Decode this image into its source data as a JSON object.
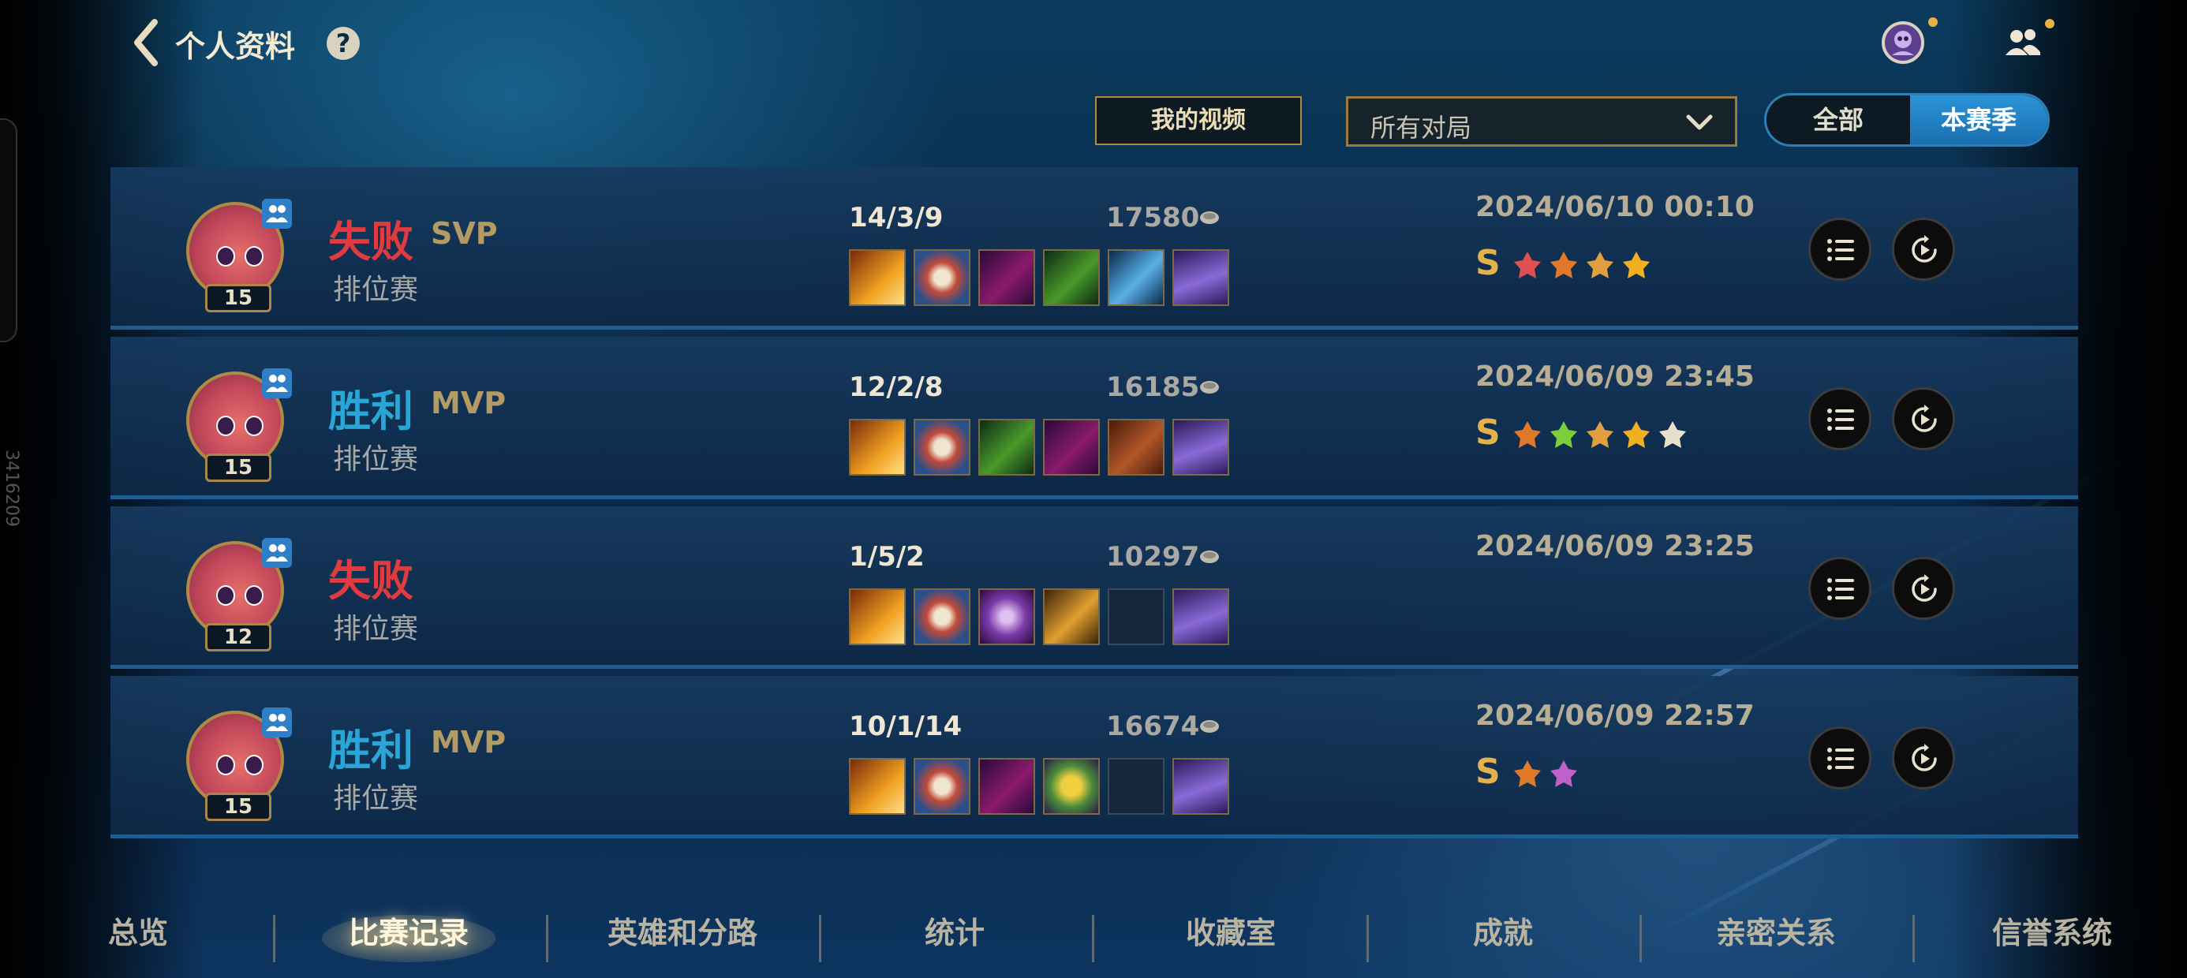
{
  "header": {
    "title": "个人资料",
    "help_label": "?"
  },
  "controls": {
    "video_button": "我的视频",
    "dropdown_value": "所有对局",
    "segment_all": "全部",
    "segment_season": "本赛季"
  },
  "side_id": "3416209",
  "matches": [
    {
      "result": "失败",
      "outcome": "loss",
      "badge": "SVP",
      "mode": "排位赛",
      "level": "15",
      "kda": "14/3/9",
      "gold": "17580",
      "date": "2024/06/10 00:10",
      "rank_letter": "S"
    },
    {
      "result": "胜利",
      "outcome": "win",
      "badge": "MVP",
      "mode": "排位赛",
      "level": "15",
      "kda": "12/2/8",
      "gold": "16185",
      "date": "2024/06/09 23:45",
      "rank_letter": "S"
    },
    {
      "result": "失败",
      "outcome": "loss",
      "badge": "",
      "mode": "排位赛",
      "level": "12",
      "kda": "1/5/2",
      "gold": "10297",
      "date": "2024/06/09 23:25",
      "rank_letter": ""
    },
    {
      "result": "胜利",
      "outcome": "win",
      "badge": "MVP",
      "mode": "排位赛",
      "level": "15",
      "kda": "10/1/14",
      "gold": "16674",
      "date": "2024/06/09 22:57",
      "rank_letter": "S"
    }
  ],
  "nav": {
    "tabs": [
      "总览",
      "比赛记录",
      "英雄和分路",
      "统计",
      "收藏室",
      "成就",
      "亲密关系",
      "信誉系统"
    ],
    "active": "比赛记录"
  },
  "colors": {
    "loss": "#e13b3f",
    "win": "#2aa6d6",
    "gold_accent": "#b08a45",
    "segment_active": "#2a94d8"
  }
}
